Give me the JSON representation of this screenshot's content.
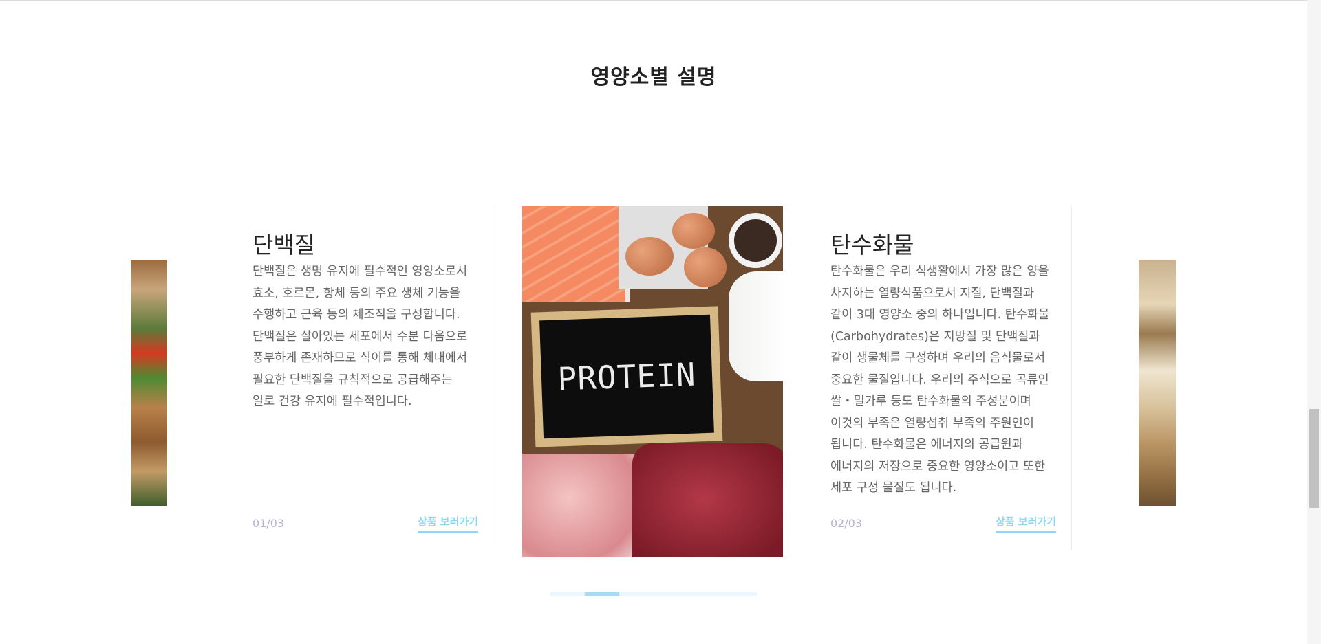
{
  "section": {
    "title": "영양소별 설명"
  },
  "slides": [
    {
      "title": "단백질",
      "description": "단백질은 생명 유지에 필수적인 영양소로서 효소, 호르몬, 항체 등의 주요 생체 기능을 수행하고 근육 등의 체조직을 구성합니다. 단백질은 살아있는 세포에서 수분 다음으로 풍부하게 존재하므로 식이를 통해 체내에서 필요한 단백질을 규칙적으로 공급해주는 일로 건강 유지에 필수적입니다.",
      "counter": "01/03",
      "link_label": "상품 보러가기"
    },
    {
      "title": "탄수화물",
      "description": "탄수화물은 우리 식생활에서 가장 많은 양을 차지하는 열량식품으로서 지질, 단백질과 같이 3대 영양소 중의 하나입니다. 탄수화물(Carbohydrates)은 지방질 및 단백질과 같이 생물체를 구성하며 우리의 음식물로서 중요한 물질입니다. 우리의 주식으로 곡류인 쌀・밀가루 등도 탄수화물의 주성분이며 이것의 부족은 열량섭취 부족의 주원인이 됩니다. 탄수화물은 에너지의 공급원과 에너지의 저장으로 중요한 영양소이고 또한 세포 구성 물질도 됩니다.",
      "counter": "02/03",
      "link_label": "상품 보러가기"
    }
  ],
  "center_image": {
    "sign_text": "PROTEIN"
  },
  "slider": {
    "progress": 0.1667
  },
  "icons": {
    "left_photo": "food-photo-icon",
    "center_photo": "protein-photo-icon",
    "right_photo": "grain-photo-icon"
  }
}
